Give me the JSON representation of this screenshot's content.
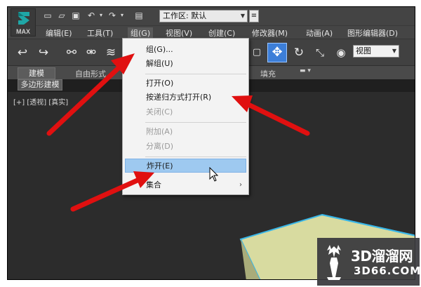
{
  "app": {
    "logo_text": "MAX"
  },
  "workspace": {
    "label": "工作区: 默认"
  },
  "menubar": {
    "items": [
      {
        "label": "编辑(E)"
      },
      {
        "label": "工具(T)"
      },
      {
        "label": "组(G)"
      },
      {
        "label": "视图(V)"
      },
      {
        "label": "创建(C)"
      },
      {
        "label": "修改器(M)"
      },
      {
        "label": "动画(A)"
      },
      {
        "label": "图形编辑器(D)"
      }
    ]
  },
  "toolbar": {
    "reference_coord": "视图"
  },
  "ribbon": {
    "tabs": [
      {
        "label": "建模"
      },
      {
        "label": "自由形式"
      },
      {
        "label": "填充"
      }
    ],
    "subtab": "多边形建模"
  },
  "viewport": {
    "label": "[+] [透视] [真实]"
  },
  "group_menu": {
    "items": [
      {
        "label": "组(G)..."
      },
      {
        "label": "解组(U)"
      },
      {
        "label": "打开(O)"
      },
      {
        "label": "按递归方式打开(R)"
      },
      {
        "label": "关闭(C)"
      },
      {
        "label": "附加(A)"
      },
      {
        "label": "分离(D)"
      },
      {
        "label": "炸开(E)"
      },
      {
        "label": "集合"
      }
    ]
  },
  "watermark": {
    "brand": "3D溜溜网",
    "url": "3D66.COM"
  },
  "colors": {
    "accent_red": "#e01010",
    "highlight_blue": "#9ec9f0",
    "cube_face": "#d8dba0",
    "cube_edge": "#38b6e8"
  }
}
